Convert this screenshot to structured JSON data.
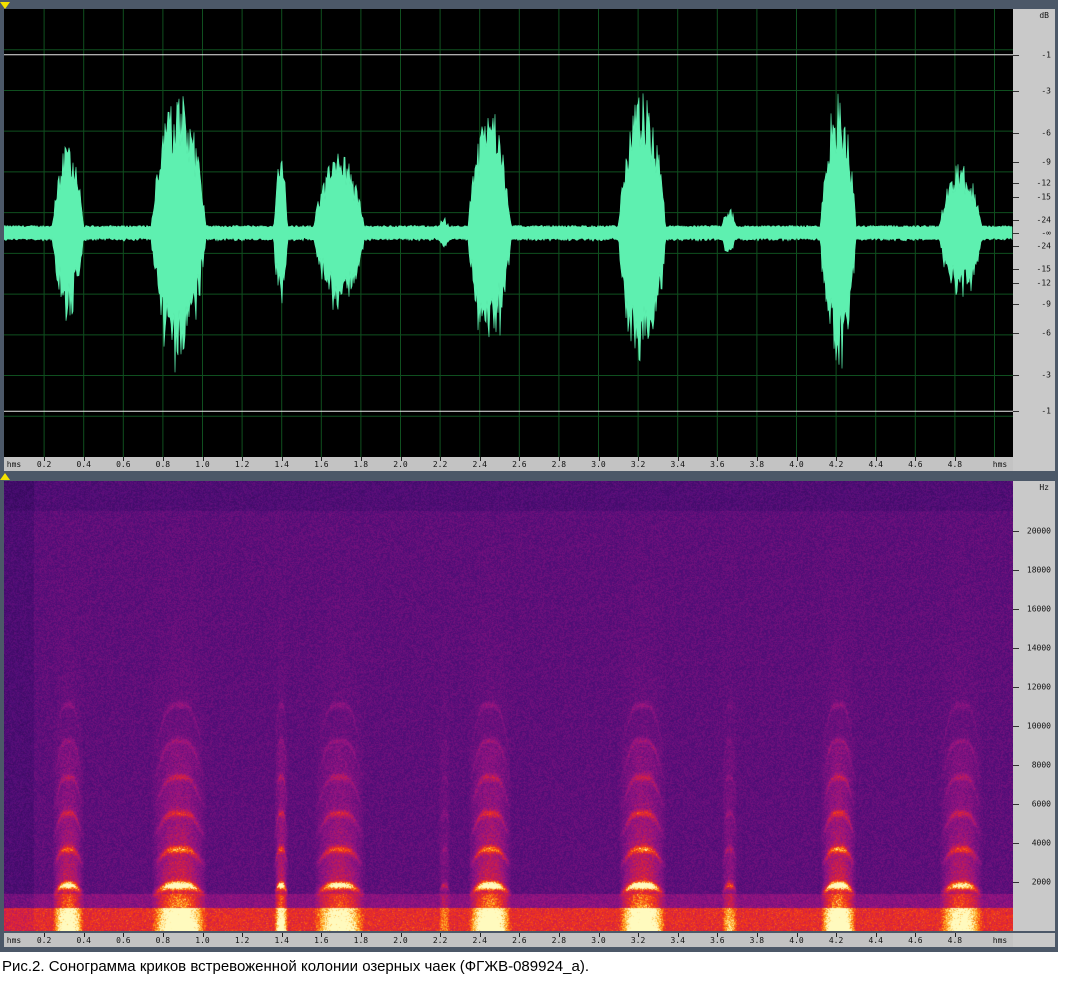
{
  "colors": {
    "waveform": "#5ef0b0",
    "grid": "#0f4f1f",
    "wave_bg": "#000000",
    "spec_bg": "#2a0855",
    "frame": "#4c5868",
    "axis_bg": "#c9c9c9"
  },
  "waveform_panel": {
    "y_unit": "dB",
    "y_labels": [
      "-1",
      "-3",
      "-6",
      "-9",
      "-12",
      "-15",
      "-24",
      "-∞",
      "-24",
      "-15",
      "-12",
      "-9",
      "-6",
      "-3",
      "-1"
    ],
    "x_start_label": "hms",
    "x_end_label": "hms",
    "x_labels": [
      "0.2",
      "0.4",
      "0.6",
      "0.8",
      "1.0",
      "1.2",
      "1.4",
      "1.6",
      "1.8",
      "2.0",
      "2.2",
      "2.4",
      "2.6",
      "2.8",
      "3.0",
      "3.2",
      "3.4",
      "3.6",
      "3.8",
      "4.0",
      "4.2",
      "4.4",
      "4.6",
      "4.8"
    ]
  },
  "spectrogram_panel": {
    "y_unit": "Hz",
    "y_labels": [
      "20000",
      "18000",
      "16000",
      "14000",
      "12000",
      "10000",
      "8000",
      "6000",
      "4000",
      "2000"
    ],
    "x_start_label": "hms",
    "x_end_label": "hms",
    "x_labels": [
      "0.2",
      "0.4",
      "0.6",
      "0.8",
      "1.0",
      "1.2",
      "1.4",
      "1.6",
      "1.8",
      "2.0",
      "2.2",
      "2.4",
      "2.6",
      "2.8",
      "3.0",
      "3.2",
      "3.4",
      "3.6",
      "3.8",
      "4.0",
      "4.2",
      "4.4",
      "4.6",
      "4.8"
    ]
  },
  "calls": [
    {
      "start_s": 0.24,
      "end_s": 0.4,
      "peak_db": -7
    },
    {
      "start_s": 0.74,
      "end_s": 1.02,
      "peak_db": -3
    },
    {
      "start_s": 1.36,
      "end_s": 1.43,
      "peak_db": -8
    },
    {
      "start_s": 1.56,
      "end_s": 1.82,
      "peak_db": -8
    },
    {
      "start_s": 2.19,
      "end_s": 2.25,
      "peak_db": -22
    },
    {
      "start_s": 2.34,
      "end_s": 2.56,
      "peak_db": -4
    },
    {
      "start_s": 3.1,
      "end_s": 3.34,
      "peak_db": -3
    },
    {
      "start_s": 3.62,
      "end_s": 3.7,
      "peak_db": -18
    },
    {
      "start_s": 4.12,
      "end_s": 4.3,
      "peak_db": -3
    },
    {
      "start_s": 4.72,
      "end_s": 4.94,
      "peak_db": -9
    }
  ],
  "caption": "Рис.2. Сонограмма криков встревоженной колонии озерных чаек (ФГЖВ-089924_а)."
}
